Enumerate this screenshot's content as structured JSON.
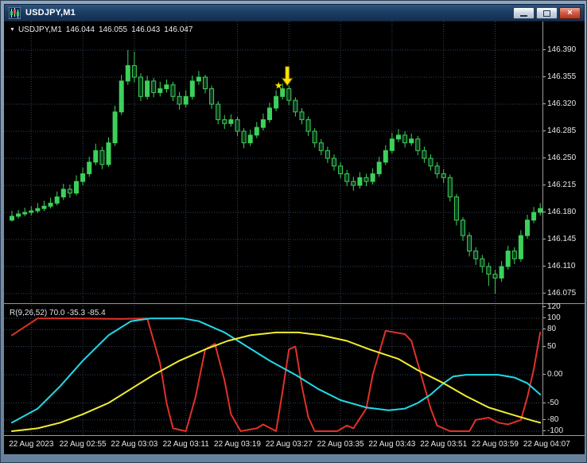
{
  "window": {
    "title": "USDJPY,M1",
    "icons": {
      "app": "candlestick-chart-icon",
      "minimize": "minimize-icon",
      "restore": "restore-icon",
      "close": "close-icon",
      "close_glyph": "×"
    }
  },
  "price_panel": {
    "dropdown_glyph": "▼",
    "symbol_period": "USDJPY,M1",
    "ohlc": {
      "open": "146.044",
      "high": "146.055",
      "low": "146.043",
      "close": "146.047"
    }
  },
  "indicator_panel": {
    "label": "R(9,26,52) 70.0 -35.3 -85.4"
  },
  "axes": {
    "price_ticks": [
      "146.390",
      "146.355",
      "146.320",
      "146.285",
      "146.250",
      "146.215",
      "146.180",
      "146.145",
      "146.110",
      "146.075"
    ],
    "indicator_ticks": [
      "120",
      "100",
      "80",
      "50",
      "0.00",
      "-50",
      "-80",
      "-100"
    ],
    "time_ticks": [
      "22 Aug 2023",
      "22 Aug 02:55",
      "22 Aug 03:03",
      "22 Aug 03:11",
      "22 Aug 03:19",
      "22 Aug 03:27",
      "22 Aug 03:35",
      "22 Aug 03:43",
      "22 Aug 03:51",
      "22 Aug 03:59",
      "22 Aug 04:07"
    ]
  },
  "colors": {
    "background": "#000000",
    "grid": "#31465f",
    "candle": "#3cd15a",
    "candle_hollow_fill": "#0c3a1c",
    "marker": "#ffe400",
    "line_red": "#e0312a",
    "line_cyan": "#22d9e8",
    "line_yellow": "#f0ee30",
    "axis_text": "#e6e6e6",
    "titlebar": "#1b3d63"
  },
  "chart_data": [
    {
      "type": "candlestick",
      "symbol": "USDJPY",
      "timeframe": "M1",
      "ylim": [
        146.06,
        146.43
      ],
      "price_grid": [
        146.39,
        146.355,
        146.32,
        146.285,
        146.25,
        146.215,
        146.18,
        146.145,
        146.11,
        146.075
      ],
      "time_grid_candle_index": [
        3,
        11,
        19,
        27,
        35,
        43,
        51,
        59,
        67,
        75,
        83
      ],
      "marker": {
        "shape": "down-arrow-with-star",
        "glyph": "★",
        "candle_index": 42,
        "price": 146.344,
        "color": "#ffe400"
      },
      "candles": [
        [
          146.17,
          146.182,
          146.168,
          146.175
        ],
        [
          146.175,
          146.183,
          146.172,
          146.178
        ],
        [
          146.178,
          146.186,
          146.175,
          146.18
        ],
        [
          146.18,
          146.188,
          146.176,
          146.182
        ],
        [
          146.182,
          146.192,
          146.179,
          146.185
        ],
        [
          146.185,
          146.195,
          146.182,
          146.188
        ],
        [
          146.188,
          146.199,
          146.185,
          146.192
        ],
        [
          146.192,
          146.207,
          146.189,
          146.2
        ],
        [
          146.2,
          146.217,
          146.196,
          146.21
        ],
        [
          146.21,
          146.216,
          146.199,
          146.205
        ],
        [
          146.205,
          146.228,
          146.202,
          146.22
        ],
        [
          146.22,
          146.238,
          146.215,
          146.23
        ],
        [
          146.23,
          146.252,
          146.226,
          146.245
        ],
        [
          146.245,
          146.269,
          146.241,
          146.26
        ],
        [
          146.26,
          146.265,
          146.236,
          146.242
        ],
        [
          146.242,
          146.277,
          146.239,
          146.27
        ],
        [
          146.27,
          146.318,
          146.266,
          146.31
        ],
        [
          146.31,
          146.358,
          146.306,
          146.35
        ],
        [
          146.35,
          146.39,
          146.345,
          146.37
        ],
        [
          146.37,
          146.388,
          146.348,
          146.355
        ],
        [
          146.355,
          146.36,
          146.324,
          146.33
        ],
        [
          146.33,
          146.357,
          146.326,
          146.35
        ],
        [
          146.35,
          146.354,
          146.329,
          146.335
        ],
        [
          146.335,
          146.349,
          146.33,
          146.34
        ],
        [
          146.34,
          146.352,
          146.335,
          146.345
        ],
        [
          146.345,
          146.349,
          146.324,
          146.33
        ],
        [
          146.33,
          146.336,
          146.313,
          146.32
        ],
        [
          146.32,
          146.338,
          146.316,
          146.33
        ],
        [
          146.33,
          146.357,
          146.326,
          146.35
        ],
        [
          146.35,
          146.363,
          146.345,
          146.355
        ],
        [
          146.355,
          146.358,
          146.334,
          146.34
        ],
        [
          146.34,
          146.344,
          146.314,
          146.32
        ],
        [
          146.32,
          146.324,
          146.294,
          146.3
        ],
        [
          146.3,
          146.306,
          146.288,
          146.295
        ],
        [
          146.295,
          146.307,
          146.291,
          146.3
        ],
        [
          146.3,
          146.304,
          146.279,
          146.285
        ],
        [
          146.285,
          146.289,
          146.263,
          146.27
        ],
        [
          146.27,
          146.287,
          146.266,
          146.28
        ],
        [
          146.28,
          146.297,
          146.276,
          146.29
        ],
        [
          146.29,
          146.308,
          146.286,
          146.3
        ],
        [
          146.3,
          146.322,
          146.296,
          146.315
        ],
        [
          146.315,
          146.338,
          146.311,
          146.33
        ],
        [
          146.33,
          146.347,
          146.326,
          146.34
        ],
        [
          146.34,
          146.344,
          146.319,
          146.325
        ],
        [
          146.325,
          146.329,
          146.304,
          146.31
        ],
        [
          146.31,
          146.315,
          146.294,
          146.3
        ],
        [
          146.3,
          146.304,
          146.279,
          146.285
        ],
        [
          146.285,
          146.289,
          146.264,
          146.27
        ],
        [
          146.27,
          146.275,
          146.254,
          146.26
        ],
        [
          146.26,
          146.265,
          146.244,
          146.25
        ],
        [
          146.25,
          146.255,
          146.234,
          146.24
        ],
        [
          146.24,
          146.245,
          146.224,
          146.23
        ],
        [
          146.23,
          146.235,
          146.214,
          146.22
        ],
        [
          146.22,
          146.226,
          146.208,
          146.215
        ],
        [
          146.215,
          146.232,
          146.211,
          146.225
        ],
        [
          146.225,
          146.23,
          146.214,
          146.22
        ],
        [
          146.22,
          146.237,
          146.216,
          146.23
        ],
        [
          146.23,
          146.252,
          146.226,
          146.245
        ],
        [
          146.245,
          146.267,
          146.241,
          146.26
        ],
        [
          146.26,
          146.283,
          146.256,
          146.275
        ],
        [
          146.275,
          146.288,
          146.271,
          146.28
        ],
        [
          146.28,
          146.285,
          146.264,
          146.27
        ],
        [
          146.27,
          146.282,
          146.266,
          146.275
        ],
        [
          146.275,
          146.279,
          146.254,
          146.26
        ],
        [
          146.26,
          146.265,
          146.244,
          146.25
        ],
        [
          146.25,
          146.255,
          146.234,
          146.24
        ],
        [
          146.24,
          146.245,
          146.224,
          146.23
        ],
        [
          146.23,
          146.236,
          146.218,
          146.225
        ],
        [
          146.225,
          146.229,
          146.194,
          146.2
        ],
        [
          146.2,
          146.204,
          146.163,
          146.17
        ],
        [
          146.17,
          146.174,
          146.143,
          146.15
        ],
        [
          146.15,
          146.154,
          146.123,
          146.13
        ],
        [
          146.13,
          146.135,
          146.112,
          146.12
        ],
        [
          146.12,
          146.125,
          146.102,
          146.11
        ],
        [
          146.11,
          146.115,
          146.085,
          146.1
        ],
        [
          146.1,
          146.106,
          146.075,
          146.095
        ],
        [
          146.095,
          146.117,
          146.09,
          146.11
        ],
        [
          146.11,
          146.137,
          146.106,
          146.13
        ],
        [
          146.13,
          146.135,
          146.113,
          146.12
        ],
        [
          146.12,
          146.157,
          146.116,
          146.15
        ],
        [
          146.15,
          146.177,
          146.146,
          146.17
        ],
        [
          146.17,
          146.187,
          146.166,
          146.18
        ],
        [
          146.18,
          146.192,
          146.176,
          146.185
        ]
      ]
    },
    {
      "type": "line",
      "name": "R(9,26,52)",
      "current_values": [
        "70.0",
        "-35.3",
        "-85.4"
      ],
      "ylim": [
        -110,
        122
      ],
      "levels": [
        100,
        80,
        50,
        0,
        -50,
        -80,
        -100
      ],
      "axis_ticks": [
        120,
        100,
        80,
        50,
        0,
        -50,
        -80,
        -100
      ],
      "series": [
        {
          "name": "signal-red",
          "color": "#e0312a",
          "points": [
            [
              0,
              70
            ],
            [
              4,
              100
            ],
            [
              10,
              100
            ],
            [
              17,
              99
            ],
            [
              21,
              100
            ],
            [
              23,
              20
            ],
            [
              24,
              -50
            ],
            [
              25,
              -95
            ],
            [
              27,
              -100
            ],
            [
              28.5,
              -40
            ],
            [
              30,
              45
            ],
            [
              31.5,
              55
            ],
            [
              33,
              -10
            ],
            [
              34,
              -70
            ],
            [
              35.5,
              -100
            ],
            [
              38,
              -95
            ],
            [
              39,
              -88
            ],
            [
              41,
              -100
            ],
            [
              42,
              -30
            ],
            [
              43,
              45
            ],
            [
              44,
              50
            ],
            [
              45,
              -20
            ],
            [
              46,
              -75
            ],
            [
              47,
              -100
            ],
            [
              50.5,
              -100
            ],
            [
              52,
              -90
            ],
            [
              53,
              -95
            ],
            [
              55,
              -60
            ],
            [
              56,
              0
            ],
            [
              58,
              78
            ],
            [
              59.5,
              75
            ],
            [
              61,
              72
            ],
            [
              62,
              60
            ],
            [
              63.5,
              0
            ],
            [
              65,
              -60
            ],
            [
              66,
              -90
            ],
            [
              68,
              -100
            ],
            [
              71,
              -100
            ],
            [
              72,
              -80
            ],
            [
              74,
              -76
            ],
            [
              75.5,
              -85
            ],
            [
              77,
              -88
            ],
            [
              79,
              -80
            ],
            [
              80,
              -40
            ],
            [
              81,
              10
            ],
            [
              82,
              75
            ]
          ]
        },
        {
          "name": "signal-cyan",
          "color": "#22d9e8",
          "points": [
            [
              0,
              -85
            ],
            [
              4,
              -60
            ],
            [
              7.5,
              -20
            ],
            [
              11,
              25
            ],
            [
              15,
              70
            ],
            [
              18.5,
              95
            ],
            [
              21.5,
              100
            ],
            [
              26.5,
              100
            ],
            [
              29,
              95
            ],
            [
              33,
              75
            ],
            [
              36.5,
              50
            ],
            [
              40,
              25
            ],
            [
              44,
              0
            ],
            [
              47.5,
              -25
            ],
            [
              51,
              -45
            ],
            [
              55,
              -58
            ],
            [
              58.5,
              -63
            ],
            [
              61,
              -60
            ],
            [
              63,
              -50
            ],
            [
              65,
              -35
            ],
            [
              67,
              -15
            ],
            [
              68.5,
              -3
            ],
            [
              70.5,
              0
            ],
            [
              75.5,
              0
            ],
            [
              78,
              -5
            ],
            [
              80,
              -15
            ],
            [
              81,
              -25
            ],
            [
              82,
              -35
            ]
          ]
        },
        {
          "name": "signal-yellow",
          "color": "#f0ee30",
          "points": [
            [
              0,
              -100
            ],
            [
              4,
              -95
            ],
            [
              7.5,
              -85
            ],
            [
              11,
              -70
            ],
            [
              15,
              -50
            ],
            [
              18.5,
              -25
            ],
            [
              22,
              0
            ],
            [
              26,
              25
            ],
            [
              30,
              45
            ],
            [
              33.5,
              60
            ],
            [
              37,
              70
            ],
            [
              41,
              75
            ],
            [
              44.5,
              75
            ],
            [
              48,
              70
            ],
            [
              52,
              60
            ],
            [
              55.5,
              45
            ],
            [
              60,
              28
            ],
            [
              63,
              8
            ],
            [
              67,
              -15
            ],
            [
              70.5,
              -38
            ],
            [
              74,
              -58
            ],
            [
              78,
              -72
            ],
            [
              81,
              -82
            ],
            [
              82,
              -85
            ]
          ]
        }
      ]
    }
  ]
}
